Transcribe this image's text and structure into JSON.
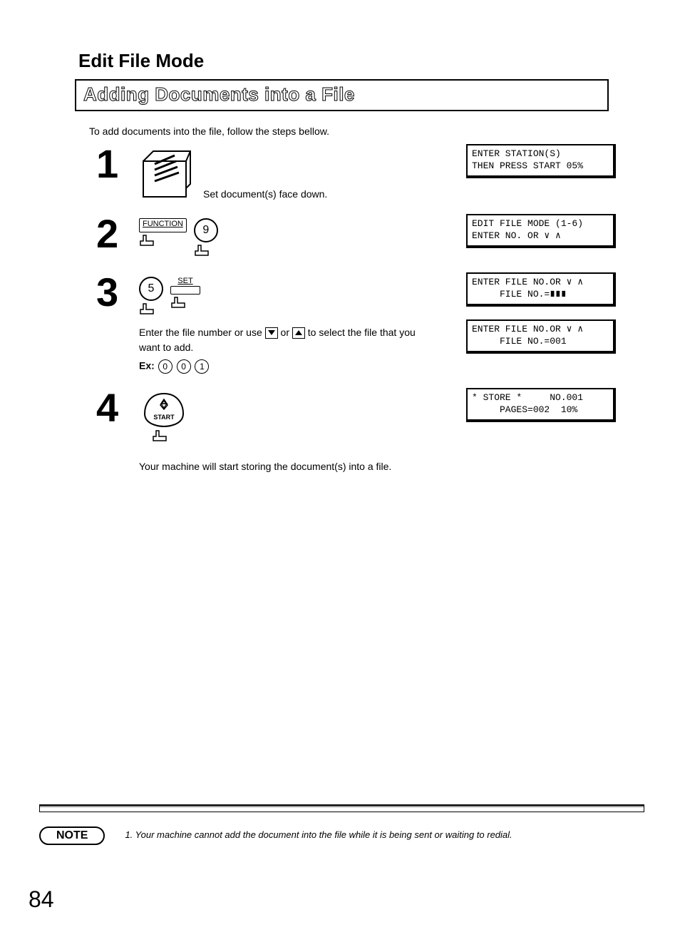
{
  "section_title": "Edit File Mode",
  "banner_title": "Adding Documents into a File",
  "intro": "To add documents into the file, follow the steps bellow.",
  "steps": {
    "s1": {
      "num": "1",
      "caption": "Set document(s) face down.",
      "lcd": "ENTER STATION(S)\nTHEN PRESS START 05%"
    },
    "s2": {
      "num": "2",
      "function_label": "FUNCTION",
      "key_digit": "9",
      "lcd": "EDIT FILE MODE (1-6)\nENTER NO. OR ∨ ∧"
    },
    "s3": {
      "num": "3",
      "key_digit": "5",
      "set_label": "SET",
      "text_before": "Enter the file number or use ",
      "text_mid": " or ",
      "text_after": " to select the file that you want to add.",
      "ex_label": "Ex:",
      "ex_d1": "0",
      "ex_d2": "0",
      "ex_d3": "1",
      "lcd_a": "ENTER FILE NO.OR ∨ ∧\n     FILE NO.=∎∎∎",
      "lcd_b": "ENTER FILE NO.OR ∨ ∧\n     FILE NO.=001"
    },
    "s4": {
      "num": "4",
      "start_label": "START",
      "caption": "Your machine will start storing the document(s) into a file.",
      "lcd": "* STORE *     NO.001\n     PAGES=002  10%"
    }
  },
  "note": {
    "label": "NOTE",
    "text": "1. Your machine cannot add the document into the file while it is being sent or waiting to redial."
  },
  "page_number": "84"
}
